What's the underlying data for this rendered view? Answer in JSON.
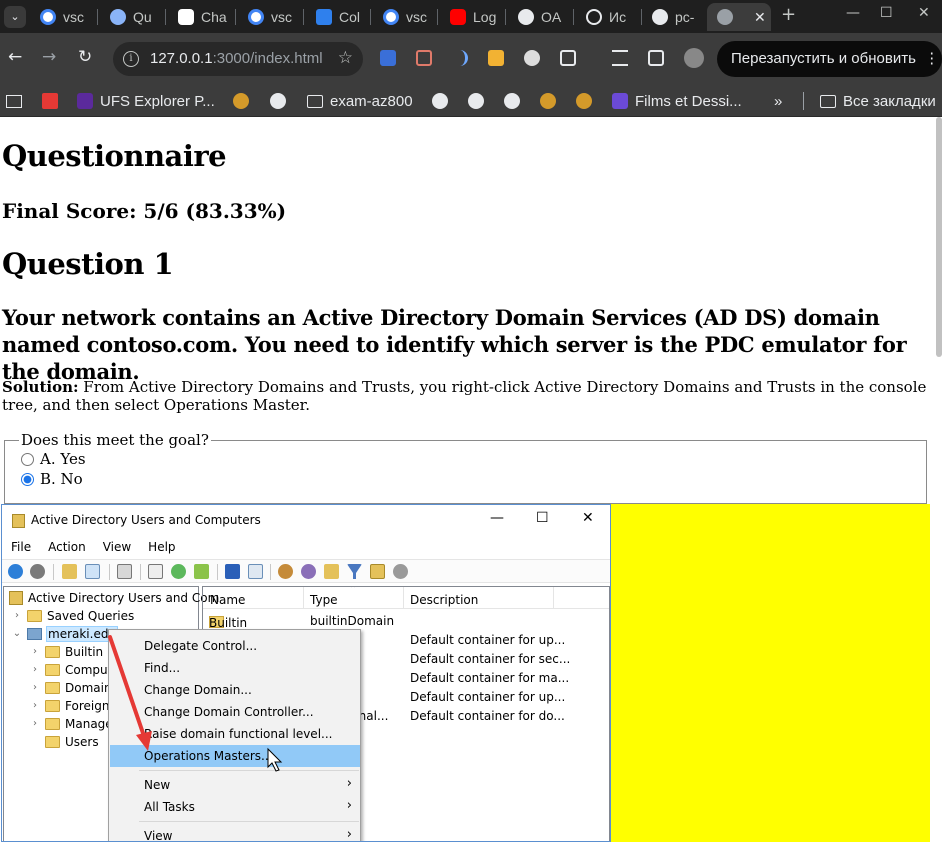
{
  "browser": {
    "tabs": [
      {
        "label": "vsc",
        "favicon_color": "#4285f4"
      },
      {
        "label": "Qu",
        "favicon_color": "#8ab4f8"
      },
      {
        "label": "Cha",
        "favicon_color": "#e8eaed"
      },
      {
        "label": "vsc",
        "favicon_color": "#4285f4"
      },
      {
        "label": "Col",
        "favicon_color": "#2f80ed"
      },
      {
        "label": "vsc",
        "favicon_color": "#4285f4"
      },
      {
        "label": "Log",
        "favicon_color": "#ff0000"
      },
      {
        "label": "OA",
        "favicon_color": "#e8eaed"
      },
      {
        "label": "Ис",
        "favicon_color": "#e8eaed"
      },
      {
        "label": "pc-",
        "favicon_color": "#e8eaed"
      },
      {
        "label": "",
        "favicon_color": "#9aa0a6"
      }
    ],
    "url_host": "127.0.0.1",
    "url_rest": ":3000/index.html",
    "restart_label": "Перезапустить и обновить",
    "bookmarks": [
      {
        "label": "UFS Explorer P..."
      },
      {
        "label": "exam-az800"
      },
      {
        "label": "Films et Dessi..."
      },
      {
        "label": "»"
      },
      {
        "label": "Все закладки"
      }
    ]
  },
  "page": {
    "title": "Questionnaire",
    "final_score": "Final Score: 5/6 (83.33%)",
    "question_heading": "Question 1",
    "question_text": "Your network contains an Active Directory Domain Services (AD DS) domain named contoso.com. You need to identify which server is the PDC emulator for the domain.",
    "solution_label": "Solution:",
    "solution_text": " From Active Directory Domains and Trusts, you right-click Active Directory Domains and Trusts in the console tree, and then select Operations Master.",
    "goal_legend": "Does this meet the goal?",
    "options": [
      {
        "label": "A. Yes",
        "checked": false
      },
      {
        "label": "B. No",
        "checked": true
      }
    ],
    "highlight_color": "#ffff00"
  },
  "aduc": {
    "window_title": "Active Directory Users and Computers",
    "menu": [
      "File",
      "Action",
      "View",
      "Help"
    ],
    "tree": [
      {
        "label": "Active Directory Users and Com"
      },
      {
        "label": "Saved Queries"
      },
      {
        "label": "meraki.edu"
      },
      {
        "label": "Builtin"
      },
      {
        "label": "Comput"
      },
      {
        "label": "Domain"
      },
      {
        "label": "Foreign"
      },
      {
        "label": "Manage"
      },
      {
        "label": "Users"
      }
    ],
    "columns": [
      "Name",
      "Type",
      "Description"
    ],
    "rows": [
      {
        "name": "Builtin",
        "type": "builtinDomain",
        "desc": ""
      },
      {
        "name": "",
        "type": "",
        "desc": "Default container for up..."
      },
      {
        "name": "",
        "type": "",
        "desc": "Default container for sec..."
      },
      {
        "name": "",
        "type": "",
        "desc": "Default container for ma..."
      },
      {
        "name": "",
        "type": "",
        "desc": "Default container for up..."
      },
      {
        "name": "",
        "type": "ional...",
        "desc": "Default container for do..."
      }
    ],
    "context_menu": [
      "Delegate Control...",
      "Find...",
      "Change Domain...",
      "Change Domain Controller...",
      "Raise domain functional level...",
      "Operations Masters...",
      "New",
      "All Tasks",
      "View"
    ],
    "annotation_color": "#e53935",
    "highlight_color": "#91c9f7"
  }
}
